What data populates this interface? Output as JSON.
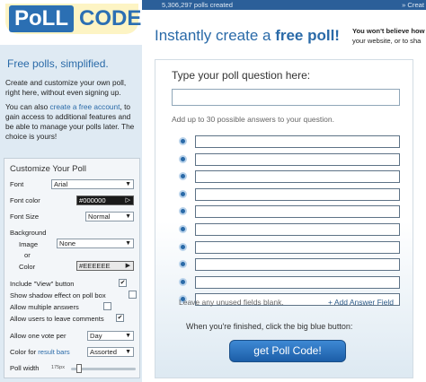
{
  "brand": {
    "logo_poll": "PoLL",
    "logo_code": "CODE",
    "tagline": "Free polls, simplified."
  },
  "intro": {
    "p1": "Create and customize your own poll, right here, without even signing up.",
    "p2_prefix": "You can also ",
    "p2_link": "create a free account",
    "p2_suffix": ", to gain access to additional features and be able to manage your polls later. The choice is yours!"
  },
  "customize": {
    "title": "Customize Your Poll",
    "font_label": "Font",
    "font_value": "Arial",
    "font_color_label": "Font color",
    "font_color_value": "#000000",
    "font_size_label": "Font Size",
    "font_size_value": "Normal",
    "background_label": "Background",
    "image_label": "Image",
    "image_value": "None",
    "or_label": "or",
    "color_label": "Color",
    "color_value": "#EEEEEE",
    "include_view_label": "Include \"View\" button",
    "shadow_label": "Show shadow effect on poll box",
    "multiple_label": "Allow multiple answers",
    "comments_label": "Allow users to leave comments",
    "one_vote_label": "Allow one vote per",
    "one_vote_value": "Day",
    "result_bars_prefix": "Color for ",
    "result_bars_link": "result bars",
    "result_bars_value": "Assorted",
    "poll_width_label": "Poll width",
    "poll_width_value": "175px",
    "checked_mark": "✔"
  },
  "topbar": {
    "count_text": "5,306,297 polls created",
    "create_text": "» Creat"
  },
  "hero": {
    "title_prefix": "Instantly create a ",
    "title_bold": "free poll!"
  },
  "side_note": {
    "line1": "You won't believe how",
    "line2": "your website, or to sha"
  },
  "card": {
    "question_label": "Type your poll question here:",
    "answers_label": "Add up to 30 possible answers to your question.",
    "leave_text": "Leave any unused fields blank.",
    "add_field_text": "+ Add Answer Field",
    "finished_text": "When you're finished, click the big blue button:",
    "button_label": "get Poll Code!",
    "answer_count": 10
  },
  "colors": {
    "accent": "#2a6aa8",
    "topbar": "#2b5f99",
    "left_bg": "#dfeaf3",
    "logo_bg": "#fdf4c4"
  },
  "icons": {
    "dropdown": "chevron-down-icon",
    "picker": "triangle-right-icon",
    "radio": "radio-icon"
  }
}
